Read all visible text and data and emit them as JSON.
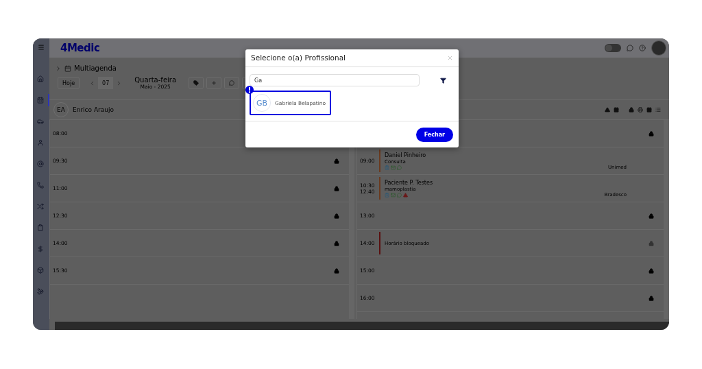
{
  "sidebar": {
    "items": [
      {
        "selected": false
      },
      {
        "selected": true
      },
      {
        "selected": false
      },
      {
        "selected": false
      },
      {
        "selected": false
      },
      {
        "selected": false
      },
      {
        "selected": false
      },
      {
        "selected": false
      },
      {
        "selected": false
      },
      {
        "selected": false
      },
      {
        "selected": false
      }
    ]
  },
  "topbar": {
    "logo": "4Medic",
    "theme_toggle": {
      "on": false
    }
  },
  "breadcrumb": "Multiagenda",
  "toolbar": {
    "today": "Hoje",
    "day": "07",
    "weekday": "Quarta-feira",
    "month": "Maio - 2025"
  },
  "professional": {
    "initials": "EA",
    "name": "Enrico Araujo"
  },
  "left_column": {
    "slots": [
      {
        "kind": "open",
        "time": "08:00"
      },
      {
        "kind": "open",
        "time": "09:30",
        "locked": true
      },
      {
        "kind": "open",
        "time": "11:00",
        "locked": true
      },
      {
        "kind": "open",
        "time": "12:30",
        "locked": true
      },
      {
        "kind": "open",
        "time": "14:00",
        "locked": true
      },
      {
        "kind": "open",
        "time": "15:30",
        "locked": true
      }
    ]
  },
  "right_column": {
    "slots": [
      {
        "kind": "open",
        "locked": true
      },
      {
        "kind": "appointment",
        "times": [
          "09:00"
        ],
        "patient": "Daniel Pinheiro",
        "procedure": "Consulta",
        "insurance": "Unimed",
        "warning": false
      },
      {
        "kind": "appointment",
        "times": [
          "10:30",
          "12:40"
        ],
        "patient": "Paciente P. Testes",
        "procedure": "mamoplastia",
        "insurance": "Bradesco",
        "warning": true
      },
      {
        "kind": "open",
        "time": "13:00",
        "locked": true
      },
      {
        "kind": "blocked",
        "time": "14:00",
        "label": "Horário bloqueado"
      },
      {
        "kind": "open",
        "time": "15:00",
        "locked": true
      },
      {
        "kind": "open",
        "time": "16:00",
        "locked": true
      }
    ]
  },
  "modal": {
    "title": "Selecione o(a) Profissional",
    "search": {
      "value": "Ga"
    },
    "results": [
      {
        "initials": "GB",
        "name": "Gabriela Belapatino",
        "highlighted": true
      }
    ],
    "close_button": "Fechar"
  }
}
